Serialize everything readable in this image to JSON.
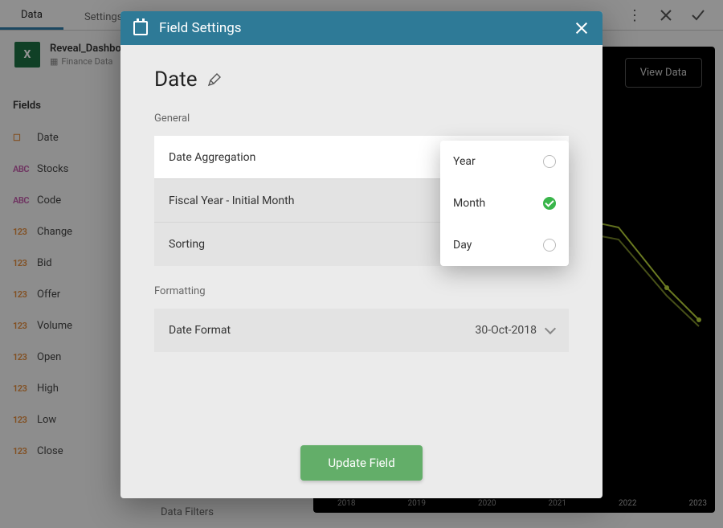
{
  "tabs": {
    "data": "Data",
    "settings": "Settings"
  },
  "source": {
    "title": "Reveal_Dashboard",
    "subtitle": "Finance Data"
  },
  "fields_header": "Fields",
  "fields": [
    {
      "icon": "date",
      "glyph": "📅",
      "label": "Date"
    },
    {
      "icon": "abc",
      "glyph": "ABC",
      "label": "Stocks"
    },
    {
      "icon": "abc",
      "glyph": "ABC",
      "label": "Code"
    },
    {
      "icon": "123",
      "glyph": "123",
      "label": "Change"
    },
    {
      "icon": "123",
      "glyph": "123",
      "label": "Bid"
    },
    {
      "icon": "123",
      "glyph": "123",
      "label": "Offer"
    },
    {
      "icon": "123",
      "glyph": "123",
      "label": "Volume"
    },
    {
      "icon": "123",
      "glyph": "123",
      "label": "Open"
    },
    {
      "icon": "123",
      "glyph": "123",
      "label": "High"
    },
    {
      "icon": "123",
      "glyph": "123",
      "label": "Low"
    },
    {
      "icon": "123",
      "glyph": "123",
      "label": "Close"
    }
  ],
  "view_data_btn": "View Data",
  "chart_years": [
    "2018",
    "2019",
    "2020",
    "2021",
    "2022",
    "2023"
  ],
  "data_filters": "Data Filters",
  "modal": {
    "title": "Field Settings",
    "field_name": "Date",
    "general_label": "General",
    "formatting_label": "Formatting",
    "rows": {
      "date_agg": "Date Aggregation",
      "fy_initial": "Fiscal Year - Initial Month",
      "sorting": "Sorting",
      "date_format": "Date Format",
      "date_format_value": "30-Oct-2018"
    },
    "update_btn": "Update Field"
  },
  "aggregation_options": [
    {
      "label": "Year",
      "selected": false
    },
    {
      "label": "Month",
      "selected": true
    },
    {
      "label": "Day",
      "selected": false
    }
  ]
}
